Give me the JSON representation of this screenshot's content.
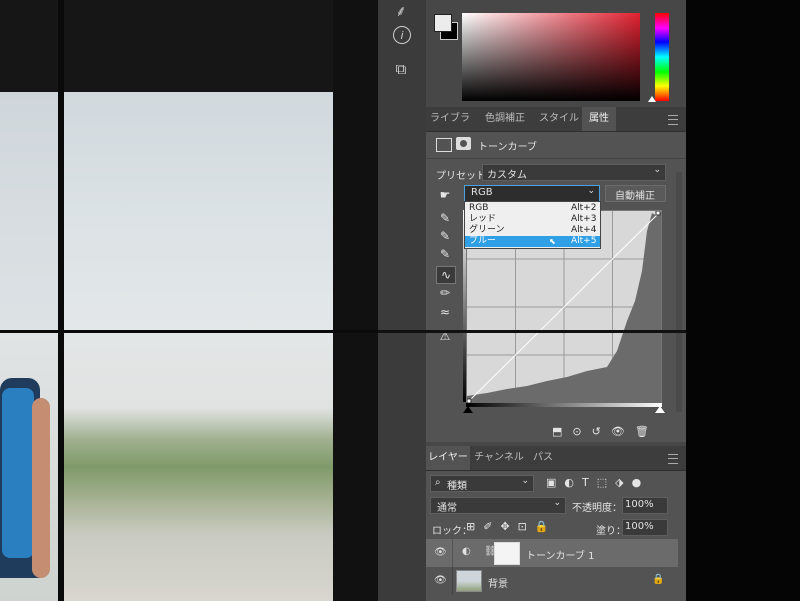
{
  "app": {
    "colors": {
      "panel": "#474747",
      "accent": "#2f9fe6",
      "curve": "#ffffff"
    }
  },
  "toolstrip": {
    "icons": [
      "brush-preset-icon",
      "info-icon",
      "puppet-icon"
    ]
  },
  "color_picker": {
    "hue_current": "red"
  },
  "properties": {
    "tabs": [
      "ライブラリ",
      "色調補正",
      "スタイル",
      "属性"
    ],
    "active_tab": "属性",
    "header_label": "トーンカーブ",
    "preset_label": "プリセット：",
    "preset_value": "カスタム",
    "channel_value": "RGB",
    "auto_button": "自動補正",
    "channel_options": [
      {
        "label": "RGB",
        "shortcut": "Alt+2"
      },
      {
        "label": "レッド",
        "shortcut": "Alt+3"
      },
      {
        "label": "グリーン",
        "shortcut": "Alt+4"
      },
      {
        "label": "ブルー",
        "shortcut": "Alt+5",
        "highlighted": true
      }
    ]
  },
  "layers": {
    "tabs": [
      "レイヤー",
      "チャンネル",
      "パス"
    ],
    "active_tab": "レイヤー",
    "filter_label": "種類",
    "blend_mode": "通常",
    "opacity_label": "不透明度：",
    "opacity_value": "100%",
    "lock_label": "ロック：",
    "fill_label": "塗り：",
    "fill_value": "100%",
    "items": [
      {
        "name": "トーンカーブ 1",
        "type": "adjustment",
        "selected": true
      },
      {
        "name": "背景",
        "type": "image",
        "locked": true
      }
    ]
  }
}
